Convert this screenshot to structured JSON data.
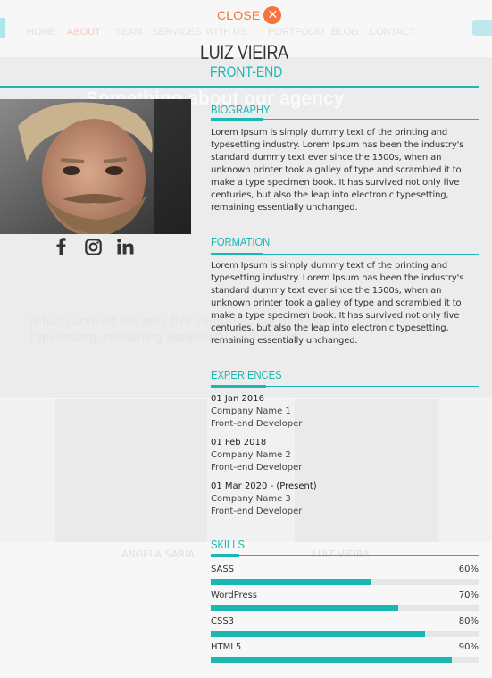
{
  "background": {
    "nav": [
      "HOME",
      "ABOUT",
      "TEAM",
      "SERVICES",
      "WITH US",
      "PORTFOLIO",
      "BLOG",
      "CONTACT"
    ],
    "band_title": "Something about our agency",
    "band_text": "It has survived not only five centuries, but also the leap into electronic typesetting, remaining essentially unchanged.",
    "team_names": [
      "ANGELA SARIA",
      "LUIZ VIEIRA"
    ]
  },
  "overlay": {
    "close_label": "CLOSE",
    "name": "LUIZ VIEIRA",
    "role": "FRONT-END",
    "social": [
      "facebook-icon",
      "instagram-icon",
      "linkedin-icon"
    ],
    "biography": {
      "title": "BIOGRAPHY",
      "text": "Lorem Ipsum is simply dummy text of the printing and typesetting industry. Lorem Ipsum has been the industry's standard dummy text ever since the 1500s, when an unknown printer took a galley of type and scrambled it to make a type specimen book. It has survived not only five centuries, but also the leap into electronic typesetting, remaining essentially unchanged."
    },
    "formation": {
      "title": "FORMATION",
      "text": "Lorem Ipsum is simply dummy text of the printing and typesetting industry. Lorem Ipsum has been the industry's standard dummy text ever since the 1500s, when an unknown printer took a galley of type and scrambled it to make a type specimen book. It has survived not only five centuries, but also the leap into electronic typesetting, remaining essentially unchanged."
    },
    "experiences": {
      "title": "EXPERIENCES",
      "items": [
        {
          "date": "01 Jan 2016",
          "company": "Company Name 1",
          "position": "Front-end Developer"
        },
        {
          "date": "01 Feb 2018",
          "company": "Company Name 2",
          "position": "Front-end Developer"
        },
        {
          "date": "01 Mar 2020 - (Present)",
          "company": "Company Name 3",
          "position": "Front-end Developer"
        }
      ]
    },
    "skills": {
      "title": "SKILLS",
      "items": [
        {
          "name": "SASS",
          "percent_label": "60%",
          "level": 0.6
        },
        {
          "name": "WordPress",
          "percent_label": "70%",
          "level": 0.7
        },
        {
          "name": "CSS3",
          "percent_label": "80%",
          "level": 0.8
        },
        {
          "name": "HTML5",
          "percent_label": "90%",
          "level": 0.9
        }
      ]
    }
  },
  "colors": {
    "accent": "#19b8b3",
    "close": "#f4743b"
  }
}
